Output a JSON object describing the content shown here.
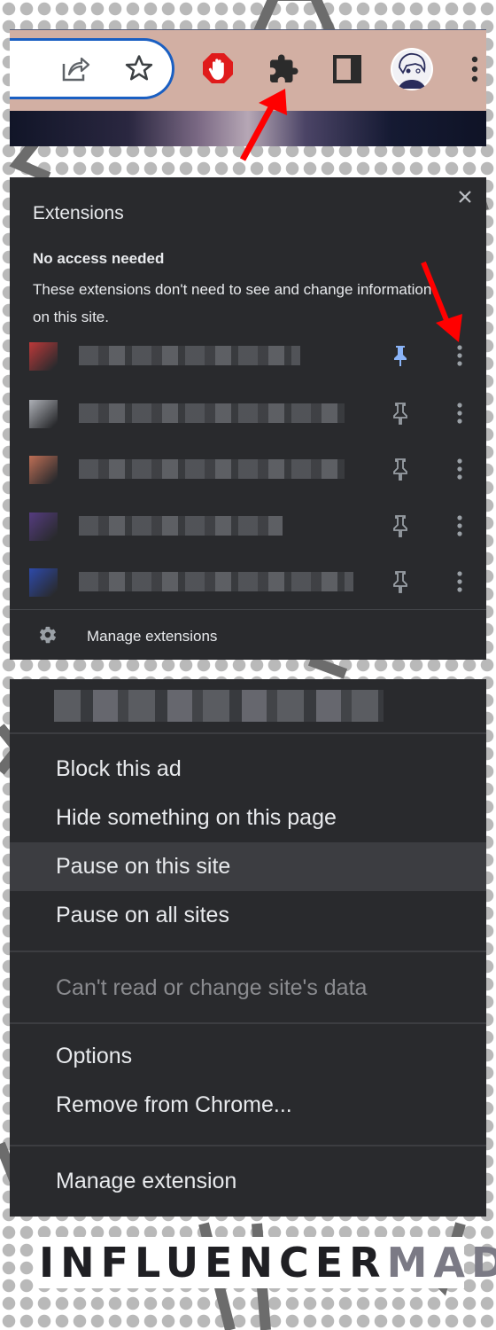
{
  "toolbar": {
    "icons": [
      "share-icon",
      "bookmark-star-icon",
      "adblock-stop-hand-icon",
      "extensions-puzzle-icon",
      "side-panel-icon",
      "profile-avatar",
      "chrome-menu-kebab-icon"
    ],
    "colors": {
      "background": "#d2afa3",
      "omnibox_border": "#1a5fc2",
      "adblock_red": "#e01b1b"
    }
  },
  "annotations": {
    "arrow_color": "#ff0000",
    "arrows": [
      "arrow-to-extensions-button",
      "arrow-to-extension-more-button"
    ]
  },
  "extensions_panel": {
    "title": "Extensions",
    "close_label": "×",
    "section_heading": "No access needed",
    "section_description": "These extensions don't need to see and change information on this site.",
    "extensions": [
      {
        "name": "[blurred]",
        "favicon_color": "#d63b3b",
        "pinned": true
      },
      {
        "name": "[blurred]",
        "favicon_color": "#c5c8cf",
        "pinned": false
      },
      {
        "name": "[blurred]",
        "favicon_color": "#d87a5c",
        "pinned": false
      },
      {
        "name": "[blurred]",
        "favicon_color": "#5d3f8e",
        "pinned": false
      },
      {
        "name": "[blurred]",
        "favicon_color": "#2e4fc0",
        "pinned": false
      }
    ],
    "manage_label": "Manage extensions",
    "pin_active_color": "#8ab4f8"
  },
  "context_menu": {
    "header": "[blurred extension name]",
    "groups": [
      [
        {
          "label": "Block this ad",
          "state": "normal"
        },
        {
          "label": "Hide something on this page",
          "state": "normal"
        },
        {
          "label": "Pause on this site",
          "state": "hover"
        },
        {
          "label": "Pause on all sites",
          "state": "normal"
        }
      ],
      [
        {
          "label": "Can't read or change site's data",
          "state": "disabled"
        }
      ],
      [
        {
          "label": "Options",
          "state": "normal"
        },
        {
          "label": "Remove from Chrome...",
          "state": "normal"
        }
      ],
      [
        {
          "label": "Manage extension",
          "state": "normal"
        }
      ]
    ]
  },
  "branding": {
    "logo_part1": "INFLUENCER",
    "logo_part2": "MADE"
  }
}
